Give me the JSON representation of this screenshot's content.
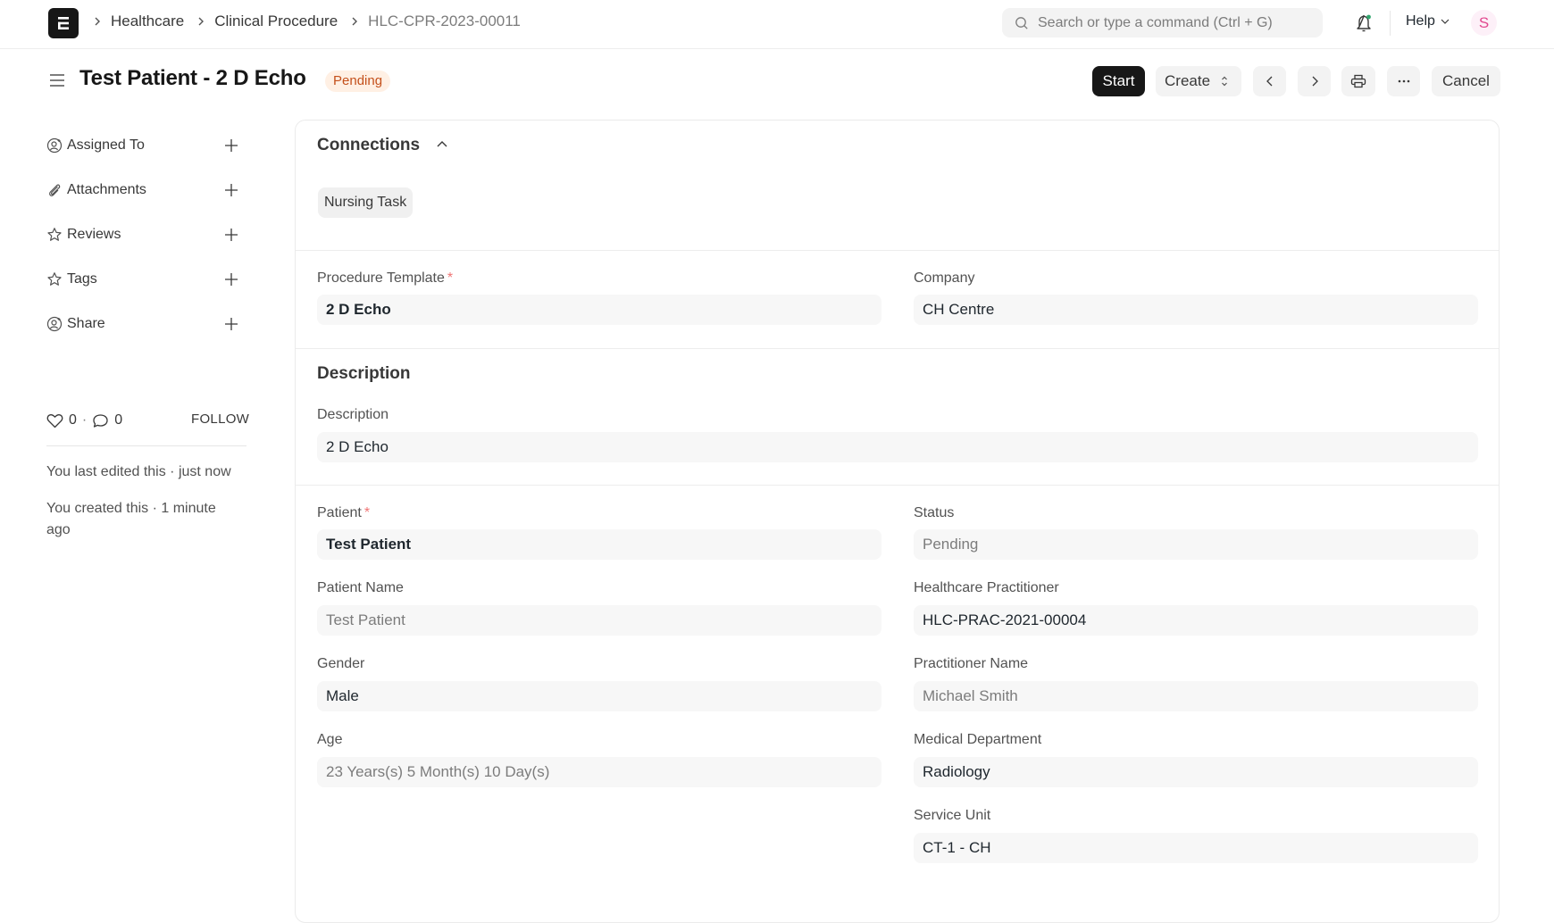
{
  "navbar": {
    "breadcrumbs": [
      "Healthcare",
      "Clinical Procedure",
      "HLC-CPR-2023-00011"
    ],
    "search_placeholder": "Search or type a command (Ctrl + G)",
    "help_label": "Help",
    "avatar_initial": "S",
    "icons": {
      "logo": "app-logo-icon",
      "search": "search-icon",
      "notifications": "bell-icon",
      "help_dropdown": "chevron-down-icon"
    }
  },
  "page": {
    "title": "Test Patient - 2 D Echo",
    "status": "Pending",
    "status_colors": {
      "bg": "#fff0e4",
      "text": "#c4501b"
    }
  },
  "actions": {
    "start": "Start",
    "create": "Create",
    "cancel": "Cancel",
    "icons": [
      "chevron-left-icon",
      "chevron-right-icon",
      "printer-icon",
      "more-horizontal-icon"
    ]
  },
  "sidebar": {
    "items": [
      {
        "label": "Assigned To",
        "icon": "user-plus-icon"
      },
      {
        "label": "Attachments",
        "icon": "paperclip-icon"
      },
      {
        "label": "Reviews",
        "icon": "star-icon"
      },
      {
        "label": "Tags",
        "icon": "star-icon"
      },
      {
        "label": "Share",
        "icon": "user-plus-icon"
      }
    ],
    "likes": "0",
    "comments": "0",
    "separator": "·",
    "follow_label": "FOLLOW",
    "last_edited": "You last edited this · just now",
    "created": "You created this · 1 minute ago"
  },
  "form": {
    "connections": {
      "title": "Connections",
      "chips": [
        "Nursing Task"
      ]
    },
    "procedure_template": {
      "label": "Procedure Template",
      "required": "*",
      "value": "2 D Echo"
    },
    "company": {
      "label": "Company",
      "value": "CH Centre"
    },
    "description_section": {
      "title": "Description",
      "field_label": "Description",
      "value": "2 D Echo"
    },
    "patient": {
      "label": "Patient",
      "required": "*",
      "value": "Test Patient"
    },
    "status": {
      "label": "Status",
      "value": "Pending"
    },
    "patient_name": {
      "label": "Patient Name",
      "value": "Test Patient"
    },
    "healthcare_practitioner": {
      "label": "Healthcare Practitioner",
      "value": "HLC-PRAC-2021-00004"
    },
    "gender": {
      "label": "Gender",
      "value": "Male"
    },
    "practitioner_name": {
      "label": "Practitioner Name",
      "value": "Michael Smith"
    },
    "age": {
      "label": "Age",
      "value": "23 Years(s) 5 Month(s) 10 Day(s)"
    },
    "medical_department": {
      "label": "Medical Department",
      "value": "Radiology"
    },
    "service_unit": {
      "label": "Service Unit",
      "value": "CT-1 - CH"
    }
  }
}
